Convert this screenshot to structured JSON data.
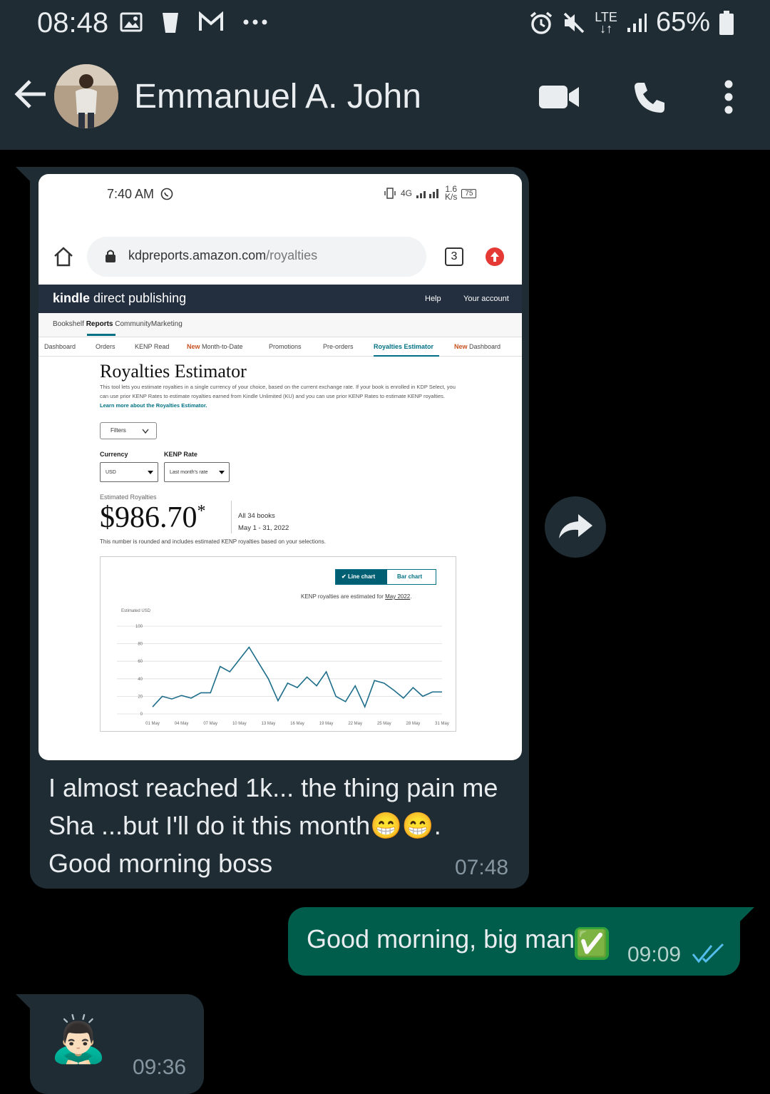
{
  "status_bar": {
    "time": "08:48",
    "left_icons": [
      "image-icon",
      "trash-icon",
      "gmail-icon",
      "more-notifications-icon"
    ],
    "battery": "65%",
    "network": "LTE"
  },
  "header": {
    "contact_name": "Emmanuel A. John"
  },
  "messages": [
    {
      "direction": "incoming",
      "text_lines": [
        "I almost reached 1k... the thing pain me",
        "Sha ...but I'll do it this month",
        "Good morning boss"
      ],
      "emoji_suffix": "😁😁.",
      "time": "07:48"
    },
    {
      "direction": "outgoing",
      "text": "Good morning, big man",
      "emoji_suffix": "✅",
      "time": "09:09"
    },
    {
      "direction": "incoming",
      "emoji": "🙇🏻‍♂️",
      "time": "09:36"
    }
  ],
  "screenshot": {
    "status_time": "7:40 AM",
    "signal_text": "4G",
    "speed_text": "1.6",
    "speed_unit": "K/s",
    "battery": "75",
    "url_domain": "kdpreports.amazon.com",
    "url_path": "/royalties",
    "tab_count": "3",
    "kdp_logo_a": "kindle",
    "kdp_logo_b": " direct publishing",
    "kdp_help": "Help",
    "kdp_account": "Your account",
    "subnav": {
      "a": "Bookshelf ",
      "b": "Reports",
      "c": " CommunityMarketing"
    },
    "tabs": {
      "dashboard": "Dashboard",
      "orders": "Orders",
      "kenp": "KENP Read",
      "mtd_new": "New",
      "mtd": " Month-to-Date",
      "promotions": "Promotions",
      "preorders": "Pre-orders",
      "estimator": "Royalties Estimator",
      "dash_new": "New",
      "dash2": " Dashboard"
    },
    "title": "Royalties Estimator",
    "description": "This tool lets you estimate royalties in a single currency of your choice, based on the current exchange rate. If your book is enrolled in KDP Select, you can use prior KENP Rates to estimate royalties earned from Kindle Unlimited (KU) and you can use prior KENP Rates to estimate KENP royalties.",
    "learn_more": "Learn more about the Royalties Estimator.",
    "filters_label": "Filters",
    "currency_label": "Currency",
    "currency_value": "USD",
    "kenp_label": "KENP Rate",
    "kenp_value": "Last month's rate",
    "estimated_label": "Estimated Royalties",
    "estimated_amount": "$986.70",
    "estimated_asterisk": "*",
    "books": "All 34 books",
    "date_range": "May 1 - 31, 2022",
    "note": "This number is rounded and includes estimated KENP royalties based on your selections.",
    "toggle_line": "Line chart",
    "toggle_bar": "Bar chart",
    "chart_note": "KENP royalties are estimated for ",
    "chart_note_month": "May 2022",
    "chart_note_end": "."
  },
  "chart_data": {
    "type": "line",
    "ylabel": "Estimated USD",
    "ylim": [
      0,
      100
    ],
    "y_ticks": [
      "100",
      "80",
      "60",
      "40",
      "20",
      "0"
    ],
    "x_tick_labels": [
      "01 May",
      "04 May",
      "07 May",
      "10 May",
      "13 May",
      "16 May",
      "19 May",
      "22 May",
      "25 May",
      "28 May",
      "31 May"
    ],
    "x": [
      1,
      2,
      3,
      4,
      5,
      6,
      7,
      8,
      9,
      10,
      11,
      12,
      13,
      14,
      15,
      16,
      17,
      18,
      19,
      20,
      21,
      22,
      23,
      24,
      25,
      26,
      27,
      28,
      29,
      30,
      31
    ],
    "series": [
      {
        "values": [
          8,
          20,
          17,
          21,
          18,
          24,
          24,
          54,
          48,
          62,
          76,
          58,
          40,
          15,
          35,
          30,
          42,
          32,
          48,
          20,
          14,
          32,
          8,
          38,
          35,
          27,
          18,
          30,
          20,
          25,
          25
        ]
      }
    ],
    "grid": true,
    "colors": {
      "line": "#1d6d8a"
    }
  },
  "colors": {
    "bg": "#000000",
    "header": "#1f2c34",
    "incoming_bubble": "#1f2c34",
    "outgoing_bubble": "#005c4b",
    "read_ticks": "#53bdeb",
    "meta_text": "#8696a0"
  }
}
